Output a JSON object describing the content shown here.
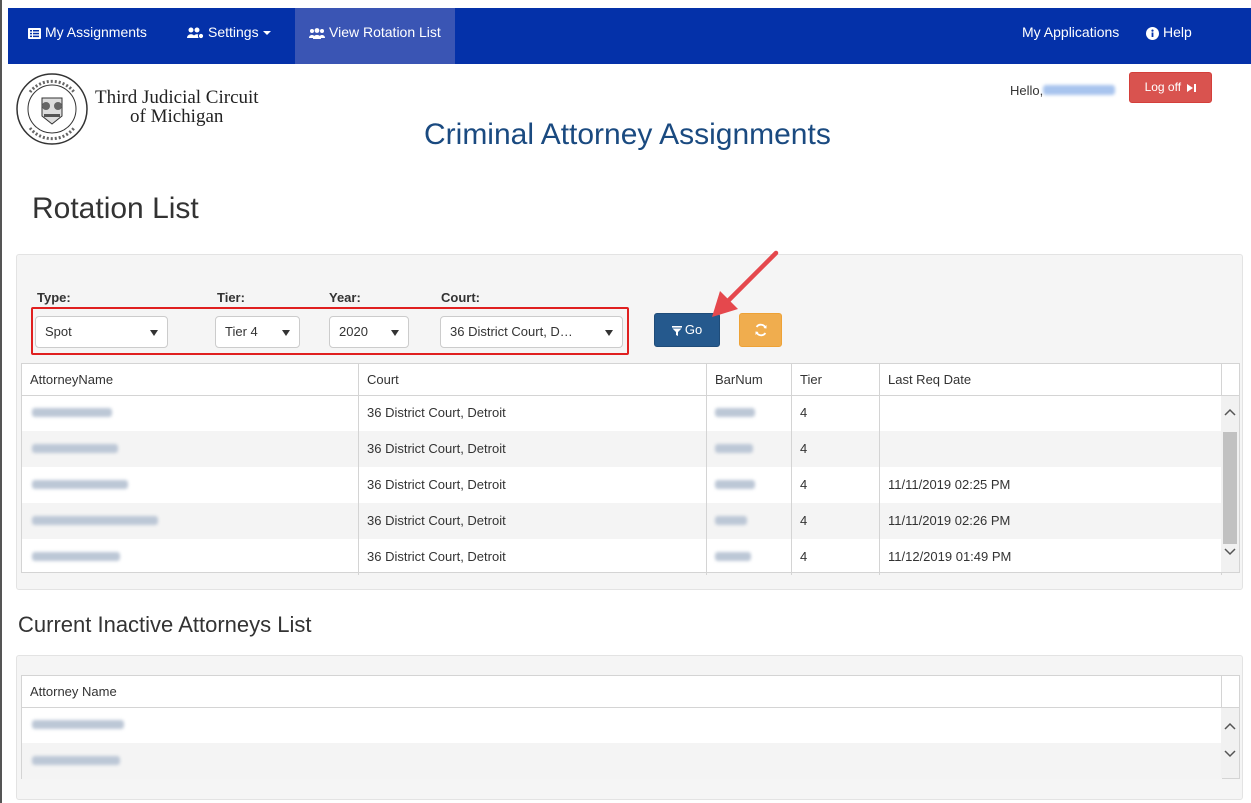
{
  "nav": {
    "my_assignments": "My Assignments",
    "settings": "Settings",
    "view_rotation_list": "View Rotation List",
    "my_applications": "My Applications",
    "help": "Help"
  },
  "header": {
    "court_line1": "Third Judicial Circuit",
    "court_line2": "of Michigan",
    "app_title": "Criminal Attorney Assignments",
    "hello": "Hello,",
    "logoff": "Log off"
  },
  "page_title": "Rotation List",
  "filters": {
    "type_label": "Type:",
    "type_value": "Spot",
    "tier_label": "Tier:",
    "tier_value": "Tier 4",
    "year_label": "Year:",
    "year_value": "2020",
    "court_label": "Court:",
    "court_value": "36 District Court, D…",
    "go_label": "Go"
  },
  "rotation_table": {
    "columns": [
      "AttorneyName",
      "Court",
      "BarNum",
      "Tier",
      "Last Req Date"
    ],
    "rows": [
      {
        "court": "36 District Court, Detroit",
        "tier": "4",
        "last_req": ""
      },
      {
        "court": "36 District Court, Detroit",
        "tier": "4",
        "last_req": ""
      },
      {
        "court": "36 District Court, Detroit",
        "tier": "4",
        "last_req": "11/11/2019 02:25 PM"
      },
      {
        "court": "36 District Court, Detroit",
        "tier": "4",
        "last_req": "11/11/2019 02:26 PM"
      },
      {
        "court": "36 District Court, Detroit",
        "tier": "4",
        "last_req": "11/12/2019 01:49 PM"
      }
    ]
  },
  "inactive_title": "Current Inactive Attorneys List",
  "inactive_table": {
    "columns": [
      "Attorney Name"
    ]
  },
  "colors": {
    "navbar": "#0431a9",
    "go_button": "#25598d",
    "refresh_button": "#f0ad4e",
    "logoff_button": "#d9534f",
    "highlight": "#e02020",
    "title": "#1a4a80"
  },
  "icons": {
    "assignments": "list-icon",
    "settings": "users-cog-icon",
    "rotation": "users-icon",
    "help": "info-circle-icon",
    "logoff": "sign-out-icon",
    "go": "filter-icon",
    "refresh": "refresh-icon"
  }
}
